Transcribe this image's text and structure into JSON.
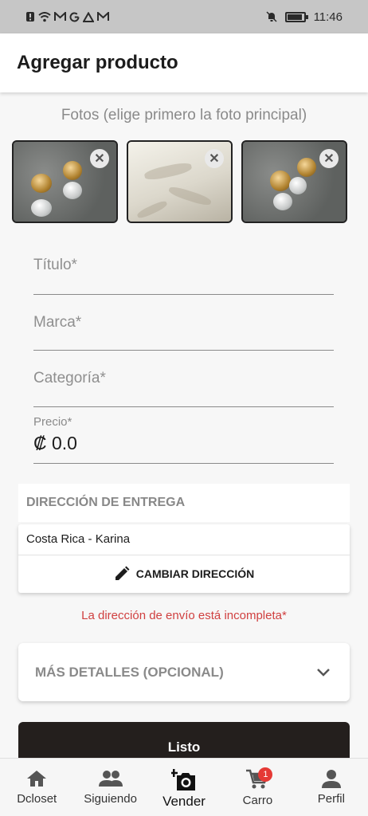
{
  "status_bar": {
    "time": "11:46"
  },
  "header": {
    "title": "Agregar producto"
  },
  "photos": {
    "title": "Fotos (elige primero la foto principal)",
    "remove_symbol": "✕",
    "items": [
      {
        "subject": "earrings"
      },
      {
        "subject": "shorts"
      },
      {
        "subject": "earrings"
      }
    ]
  },
  "form": {
    "title_label": "Título*",
    "title_value": "",
    "brand_label": "Marca*",
    "brand_value": "",
    "category_label": "Categoría*",
    "category_value": "",
    "price_label": "Precio*",
    "price_value": "₡ 0.0"
  },
  "delivery": {
    "header": "DIRECCIÓN DE ENTREGA",
    "address": "Costa Rica - Karina",
    "change_label": "CAMBIAR DIRECCIÓN",
    "error": "La dirección de envío está incompleta*"
  },
  "more_details": {
    "label": "MÁS DETALLES (OPCIONAL)"
  },
  "actions": {
    "done_label": "Listo"
  },
  "bottom_nav": {
    "items": [
      {
        "label": "Dcloset",
        "icon": "home-icon"
      },
      {
        "label": "Siguiendo",
        "icon": "people-icon"
      },
      {
        "label": "Vender",
        "icon": "add-camera-icon",
        "active": true
      },
      {
        "label": "Carro",
        "icon": "cart-icon",
        "badge": "1"
      },
      {
        "label": "Perfil",
        "icon": "person-icon"
      }
    ]
  },
  "colors": {
    "primary": "#241f1d",
    "error": "#d04040",
    "badge": "#e53935",
    "status_bar": "#c6c6c6"
  }
}
